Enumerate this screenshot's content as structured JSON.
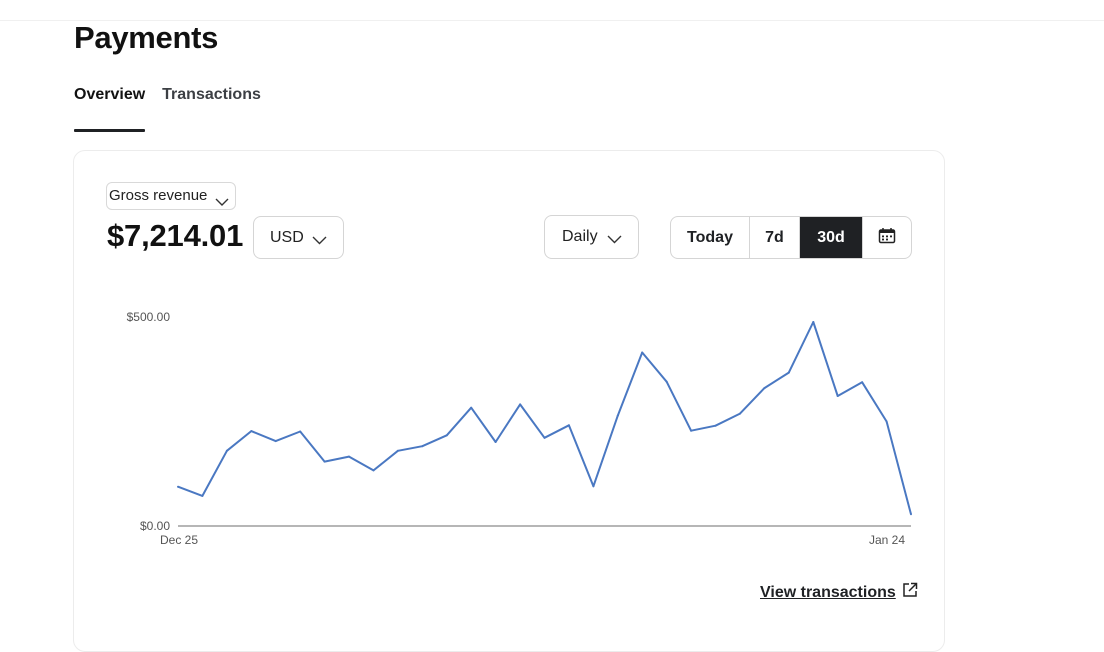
{
  "page": {
    "title": "Payments"
  },
  "tabs": [
    {
      "label": "Overview",
      "active": true
    },
    {
      "label": "Transactions",
      "active": false
    }
  ],
  "metric": {
    "selected": "Gross revenue",
    "total": "$7,214.01"
  },
  "currency": {
    "selected": "USD"
  },
  "interval": {
    "selected": "Daily"
  },
  "range": {
    "options": [
      "Today",
      "7d",
      "30d"
    ],
    "selected": "30d"
  },
  "footer": {
    "view_transactions_label": "View transactions"
  },
  "colors": {
    "line": "#4a78c2",
    "active_segment": "#1f2124"
  },
  "icons": {
    "calendar": "calendar-icon",
    "external": "external-link-icon",
    "chevron": "chevron-down-icon"
  },
  "chart_data": {
    "type": "line",
    "title": "",
    "xlabel": "",
    "ylabel": "",
    "x_tick_labels": [
      "Dec 25",
      "Jan 24"
    ],
    "y_tick_labels": [
      "$0.00",
      "$500.00"
    ],
    "ylim": [
      0,
      500
    ],
    "grid": false,
    "series": [
      {
        "values": [
          94,
          72,
          180,
          227,
          203,
          226,
          154,
          166,
          133,
          180,
          191,
          217,
          283,
          201,
          291,
          211,
          241,
          95,
          264,
          415,
          345,
          228,
          240,
          269,
          330,
          367,
          488,
          311,
          344,
          250,
          28
        ]
      }
    ]
  }
}
